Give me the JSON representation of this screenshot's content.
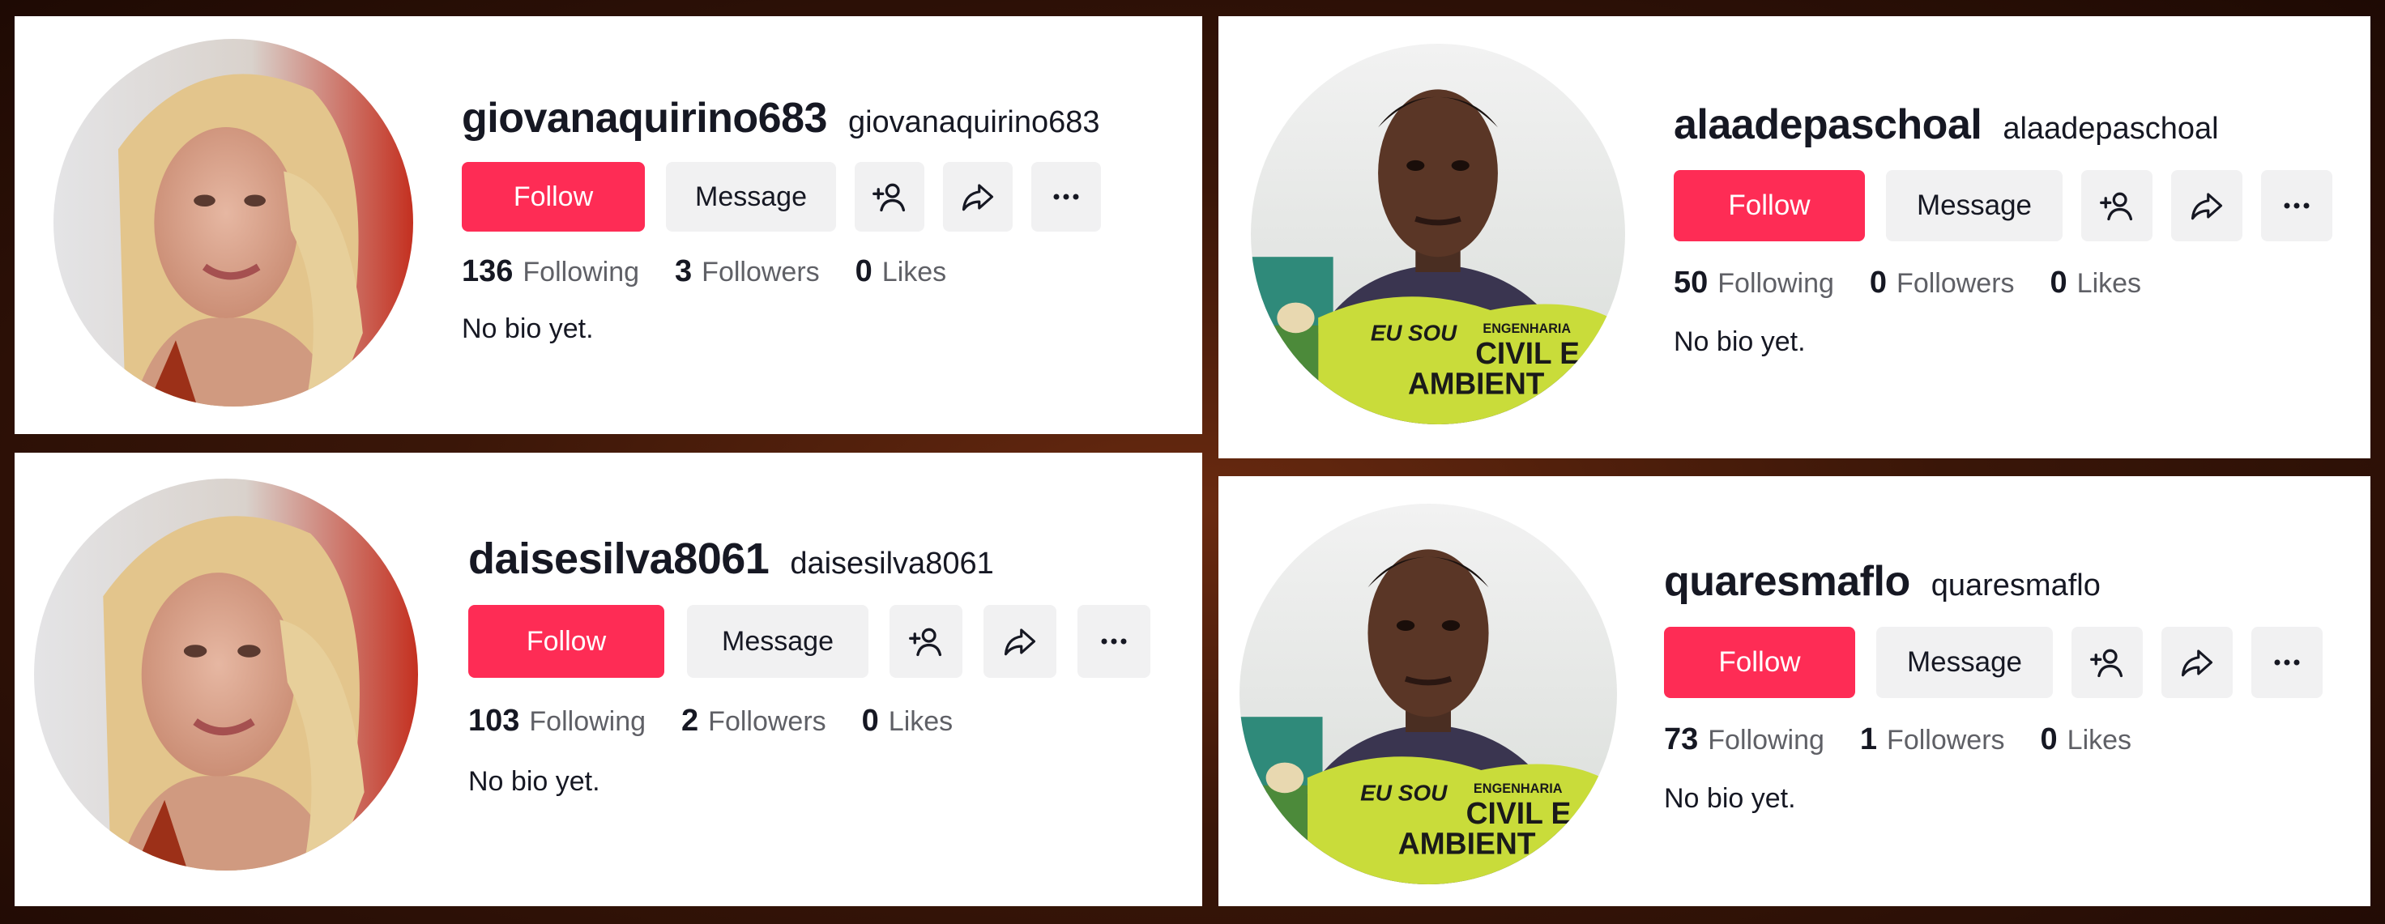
{
  "colors": {
    "follow_button": "#fe2c55",
    "secondary_button": "#f1f1f2",
    "text_primary": "#161823",
    "text_secondary": "#5f6066"
  },
  "profiles": [
    {
      "username": "giovanaquirino683",
      "nickname": "giovanaquirino683",
      "follow_label": "Follow",
      "message_label": "Message",
      "icons": [
        "add-friend-icon",
        "share-icon",
        "more-icon"
      ],
      "following_count": "136",
      "following_label": "Following",
      "followers_count": "3",
      "followers_label": "Followers",
      "likes_count": "0",
      "likes_label": "Likes",
      "bio": "No bio yet."
    },
    {
      "username": "alaadepaschoal",
      "nickname": "alaadepaschoal",
      "follow_label": "Follow",
      "message_label": "Message",
      "icons": [
        "add-friend-icon",
        "share-icon",
        "more-icon"
      ],
      "following_count": "50",
      "following_label": "Following",
      "followers_count": "0",
      "followers_label": "Followers",
      "likes_count": "0",
      "likes_label": "Likes",
      "bio": "No bio yet."
    },
    {
      "username": "daisesilva8061",
      "nickname": "daisesilva8061",
      "follow_label": "Follow",
      "message_label": "Message",
      "icons": [
        "add-friend-icon",
        "share-icon",
        "more-icon"
      ],
      "following_count": "103",
      "following_label": "Following",
      "followers_count": "2",
      "followers_label": "Followers",
      "likes_count": "0",
      "likes_label": "Likes",
      "bio": "No bio yet."
    },
    {
      "username": "quaresmaflo",
      "nickname": "quaresmaflo",
      "follow_label": "Follow",
      "message_label": "Message",
      "icons": [
        "add-friend-icon",
        "share-icon",
        "more-icon"
      ],
      "following_count": "73",
      "following_label": "Following",
      "followers_count": "1",
      "followers_label": "Followers",
      "likes_count": "0",
      "likes_label": "Likes",
      "bio": "No bio yet."
    }
  ],
  "avatar_shirt_text": [
    "EU SOU",
    "ENGENHARIA",
    "CIVIL E",
    "AMBIENT"
  ]
}
